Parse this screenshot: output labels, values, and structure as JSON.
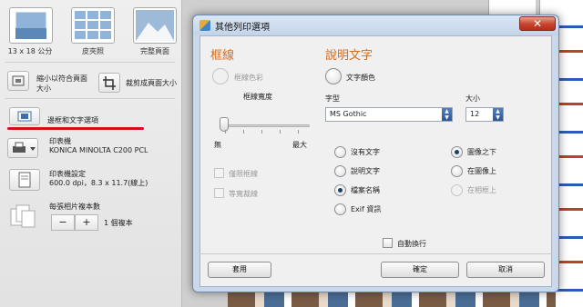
{
  "left_panel": {
    "thumbnails": [
      {
        "label": "13 x 18 公分"
      },
      {
        "label": "皮夾照"
      },
      {
        "label": "完整頁面"
      }
    ],
    "fit_option": "縮小以符合頁面大小",
    "crop_option": "裁剪成頁面大小",
    "border_text_option": "邊框和文字選項",
    "printer_label": "印表機",
    "printer_name": "KONICA MINOLTA C200 PCL",
    "printer_settings_label": "印表機設定",
    "printer_settings_value": "600.0 dpi，8.3 x 11.7(線上)",
    "copies_label": "每張相片複本數",
    "minus": "−",
    "plus": "+",
    "copies_value": "1 個複本"
  },
  "dialog": {
    "title": "其他列印選項",
    "close": "✕",
    "border_section": {
      "heading": "框線",
      "border_color": "框線色彩",
      "border_width_label": "框線寬度",
      "slider_min_label": "無",
      "slider_max_label": "最大",
      "draw_frame": "僅限框線",
      "rotate_with_photo": "等寬裁線"
    },
    "caption_section": {
      "heading": "說明文字",
      "text_color": "文字顏色",
      "font_label": "字型",
      "font_value": "MS Gothic",
      "size_label": "大小",
      "size_value": "12",
      "text_options": [
        {
          "label": "沒有文字",
          "checked": false
        },
        {
          "label": "說明文字",
          "checked": false
        },
        {
          "label": "檔案名稱",
          "checked": true
        },
        {
          "label": "Exif 資訊",
          "checked": false
        }
      ],
      "position_options": [
        {
          "label": "圖像之下",
          "checked": true
        },
        {
          "label": "在圖像上",
          "checked": false
        },
        {
          "label": "在相框上",
          "checked": false
        }
      ],
      "wrap_text": "自動換行"
    },
    "buttons": {
      "apply": "套用",
      "ok": "確定",
      "cancel": "取消"
    }
  }
}
